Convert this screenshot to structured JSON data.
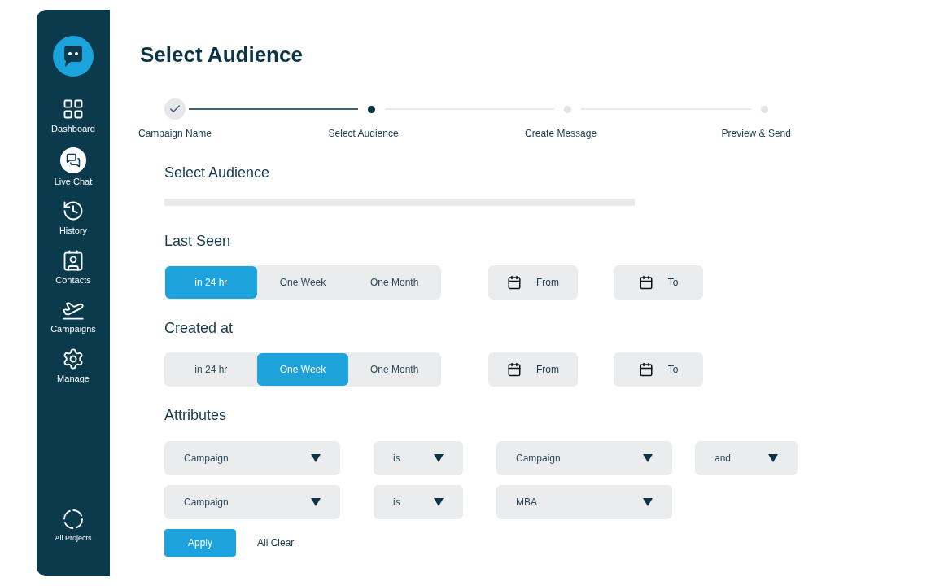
{
  "sidebar": {
    "items": [
      {
        "label": "Dashboard",
        "selected": false
      },
      {
        "label": "Live Chat",
        "selected": true
      },
      {
        "label": "History",
        "selected": false
      },
      {
        "label": "Contacts",
        "selected": false
      },
      {
        "label": "Campaigns",
        "selected": false
      },
      {
        "label": "Manage",
        "selected": false
      }
    ],
    "footer": {
      "label": "All Projects"
    }
  },
  "title": "Select Audience",
  "steps": [
    {
      "label": "Campaign Name",
      "kind": "done"
    },
    {
      "label": "Select Audience",
      "kind": "current"
    },
    {
      "label": "Create Message",
      "kind": "upcoming"
    },
    {
      "label": "Preview & Send",
      "kind": "upcoming"
    }
  ],
  "section_title": "Select Audience",
  "filters": [
    {
      "title": "Last Seen",
      "options": [
        {
          "label": "in 24 hr",
          "selected": true
        },
        {
          "label": "One Week",
          "selected": false
        },
        {
          "label": "One Month",
          "selected": false
        }
      ],
      "from": "From",
      "to": "To"
    },
    {
      "title": "Created at",
      "options": [
        {
          "label": "in 24 hr",
          "selected": false
        },
        {
          "label": "One Week",
          "selected": true
        },
        {
          "label": "One Month",
          "selected": false
        }
      ],
      "from": "From",
      "to": "To"
    }
  ],
  "attributes": {
    "title": "Attributes",
    "rows": [
      [
        "Campaign",
        "is",
        "Campaign",
        "and"
      ],
      [
        "Campaign",
        "is",
        "MBA"
      ]
    ]
  },
  "buttons": {
    "apply": "Apply",
    "clear": "All Clear"
  }
}
